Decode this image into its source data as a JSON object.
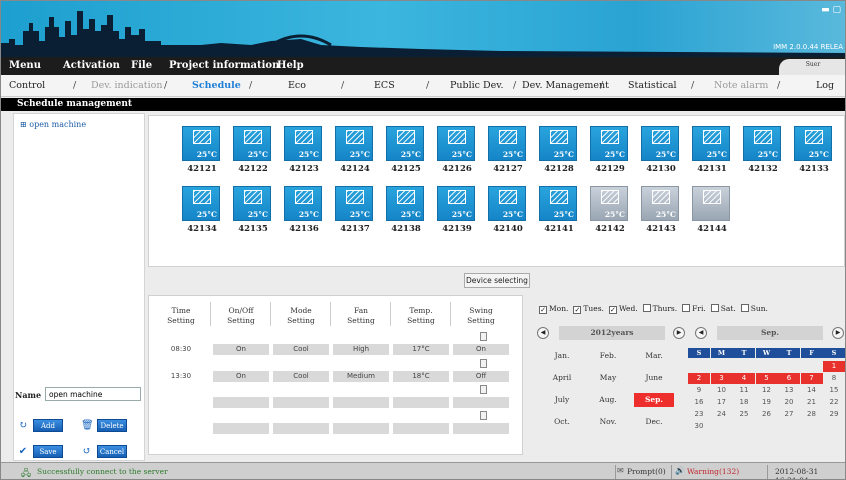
{
  "app": {
    "version": "IMM 2.0.0.44 RELEA",
    "window_controls": "▬ ▢",
    "user_tab": "Suer"
  },
  "menu": [
    "Menu",
    "Activation",
    "File",
    "Project information",
    "Help"
  ],
  "tabs": [
    {
      "label": "Control",
      "state": "normal"
    },
    {
      "label": "Dev. indication",
      "state": "dim"
    },
    {
      "label": "Schedule",
      "state": "active"
    },
    {
      "label": "Eco",
      "state": "normal"
    },
    {
      "label": "ECS",
      "state": "normal"
    },
    {
      "label": "Public Dev.",
      "state": "normal"
    },
    {
      "label": "Dev. Management",
      "state": "normal"
    },
    {
      "label": "Statistical",
      "state": "normal"
    },
    {
      "label": "Note alarm",
      "state": "dim"
    },
    {
      "label": "Log",
      "state": "normal"
    }
  ],
  "tab_separator": "/",
  "section_title": "Schedule management",
  "left_panel": {
    "tree_item": "open machine",
    "name_label": "Name",
    "name_value": "open machine",
    "add_label": "Add",
    "delete_label": "Delete",
    "save_label": "Save",
    "cancel_label": "Cancel"
  },
  "devices": [
    {
      "id": "42121",
      "temp": "25°C",
      "active": true
    },
    {
      "id": "42122",
      "temp": "25°C",
      "active": true
    },
    {
      "id": "42123",
      "temp": "25°C",
      "active": true
    },
    {
      "id": "42124",
      "temp": "25°C",
      "active": true
    },
    {
      "id": "42125",
      "temp": "25°C",
      "active": true
    },
    {
      "id": "42126",
      "temp": "25°C",
      "active": true
    },
    {
      "id": "42127",
      "temp": "25°C",
      "active": true
    },
    {
      "id": "42128",
      "temp": "25°C",
      "active": true
    },
    {
      "id": "42129",
      "temp": "25°C",
      "active": true
    },
    {
      "id": "42130",
      "temp": "25°C",
      "active": true
    },
    {
      "id": "42131",
      "temp": "25°C",
      "active": true
    },
    {
      "id": "42132",
      "temp": "25°C",
      "active": true
    },
    {
      "id": "42133",
      "temp": "25°C",
      "active": true
    },
    {
      "id": "42134",
      "temp": "25°C",
      "active": true
    },
    {
      "id": "42135",
      "temp": "25°C",
      "active": true
    },
    {
      "id": "42136",
      "temp": "25°C",
      "active": true
    },
    {
      "id": "42137",
      "temp": "25°C",
      "active": true
    },
    {
      "id": "42138",
      "temp": "25°C",
      "active": true
    },
    {
      "id": "42139",
      "temp": "25°C",
      "active": true
    },
    {
      "id": "42140",
      "temp": "25°C",
      "active": true
    },
    {
      "id": "42141",
      "temp": "25°C",
      "active": true
    },
    {
      "id": "42142",
      "temp": "25°C",
      "active": false
    },
    {
      "id": "42143",
      "temp": "25°C",
      "active": false
    },
    {
      "id": "42144",
      "temp": "",
      "active": false
    }
  ],
  "device_selecting_label": "Device selecting",
  "schedule_table": {
    "headers": [
      [
        "Time",
        "Setting"
      ],
      [
        "On/Off",
        "Setting"
      ],
      [
        "Mode",
        "Setting"
      ],
      [
        "Fan",
        "Setting"
      ],
      [
        "Temp.",
        "Setting"
      ],
      [
        "Swing",
        "Setting"
      ]
    ],
    "rows": [
      [
        "08:30",
        "On",
        "Cool",
        "High",
        "17°C",
        "On"
      ],
      [
        "13:30",
        "On",
        "Cool",
        "Medium",
        "18°C",
        "Off"
      ],
      [
        "",
        "",
        "",
        "",
        "",
        ""
      ],
      [
        "",
        "",
        "",
        "",
        "",
        ""
      ]
    ]
  },
  "weekdays": [
    {
      "label": "Mon.",
      "checked": true
    },
    {
      "label": "Tues.",
      "checked": true
    },
    {
      "label": "Wed.",
      "checked": true
    },
    {
      "label": "Thurs.",
      "checked": false
    },
    {
      "label": "Fri.",
      "checked": false
    },
    {
      "label": "Sat.",
      "checked": false
    },
    {
      "label": "Sun.",
      "checked": false
    }
  ],
  "year_calendar": {
    "year_label": "2012years",
    "months": [
      "Jan.",
      "Feb.",
      "Mar.",
      "April",
      "May",
      "June",
      "July",
      "Aug.",
      "Sep.",
      "Oct.",
      "Nov.",
      "Dec."
    ],
    "selected_month": "Sep."
  },
  "month_calendar": {
    "month_label": "Sep.",
    "day_headers": [
      "S",
      "M",
      "T",
      "W",
      "T",
      "F",
      "S"
    ],
    "days": [
      [
        "",
        "",
        "",
        "",
        "",
        "",
        "1"
      ],
      [
        "2",
        "3",
        "4",
        "5",
        "6",
        "7",
        "8"
      ],
      [
        "9",
        "10",
        "11",
        "12",
        "13",
        "14",
        "15"
      ],
      [
        "16",
        "17",
        "18",
        "19",
        "20",
        "21",
        "22"
      ],
      [
        "23",
        "24",
        "25",
        "26",
        "27",
        "28",
        "29"
      ],
      [
        "30",
        "",
        "",
        "",
        "",
        "",
        ""
      ]
    ],
    "highlighted_days": [
      "1",
      "2",
      "3",
      "4",
      "5",
      "6",
      "7"
    ]
  },
  "status": {
    "message": "Successfully connect to the server",
    "prompt": "Prompt(0)",
    "warning": "Warning(132)",
    "datetime": "2012-08-31 16:21:04"
  },
  "colors": {
    "header": "#2aa3d3",
    "active_tab": "#1f7fd6",
    "device_on": "#1e95d4",
    "highlight_red": "#e8312c",
    "calendar_head": "#1f4f9a"
  }
}
